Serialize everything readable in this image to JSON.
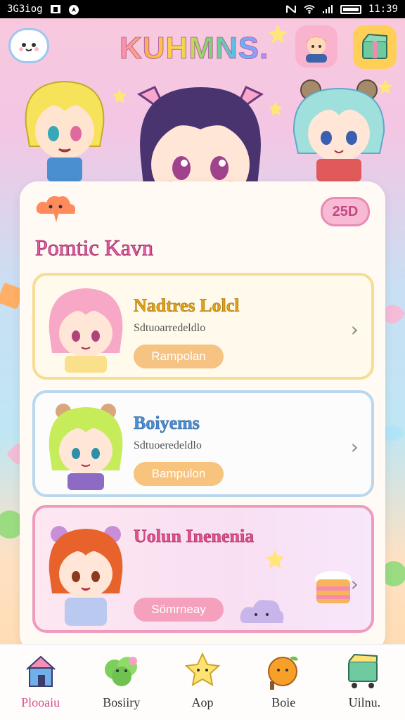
{
  "status_bar": {
    "left_text": "3G3iog",
    "time": "11:39"
  },
  "header": {
    "app_title": "KUHMNS.",
    "chat_icon": "chat-bubble-icon",
    "profile_icon": "avatar-icon",
    "box_icon": "gift-box-icon"
  },
  "card": {
    "badge": "25D",
    "title": "Pomtic Kavn",
    "items": [
      {
        "title": "Nadtres Lolcl",
        "subtitle": "Sdtuoarredeldlo",
        "button": "Rampolan"
      },
      {
        "title": "Boiyems",
        "subtitle": "Sdtuoeredeldlo",
        "button": "Bampulon"
      },
      {
        "title": "Uolun Inenenia",
        "subtitle": "",
        "button": "Sömrneay"
      }
    ]
  },
  "bottom_nav": [
    {
      "label": "Plooaiu",
      "icon": "house-icon"
    },
    {
      "label": "Bosiiry",
      "icon": "bush-icon"
    },
    {
      "label": "Aop",
      "icon": "star-icon"
    },
    {
      "label": "Boie",
      "icon": "fruit-icon"
    },
    {
      "label": "Uilnu.",
      "icon": "cart-icon"
    }
  ],
  "colors": {
    "accent": "#e85fa8",
    "yellow_border": "#f7dd92",
    "blue_border": "#b9d7ee",
    "pink_border": "#ee9bbd"
  }
}
